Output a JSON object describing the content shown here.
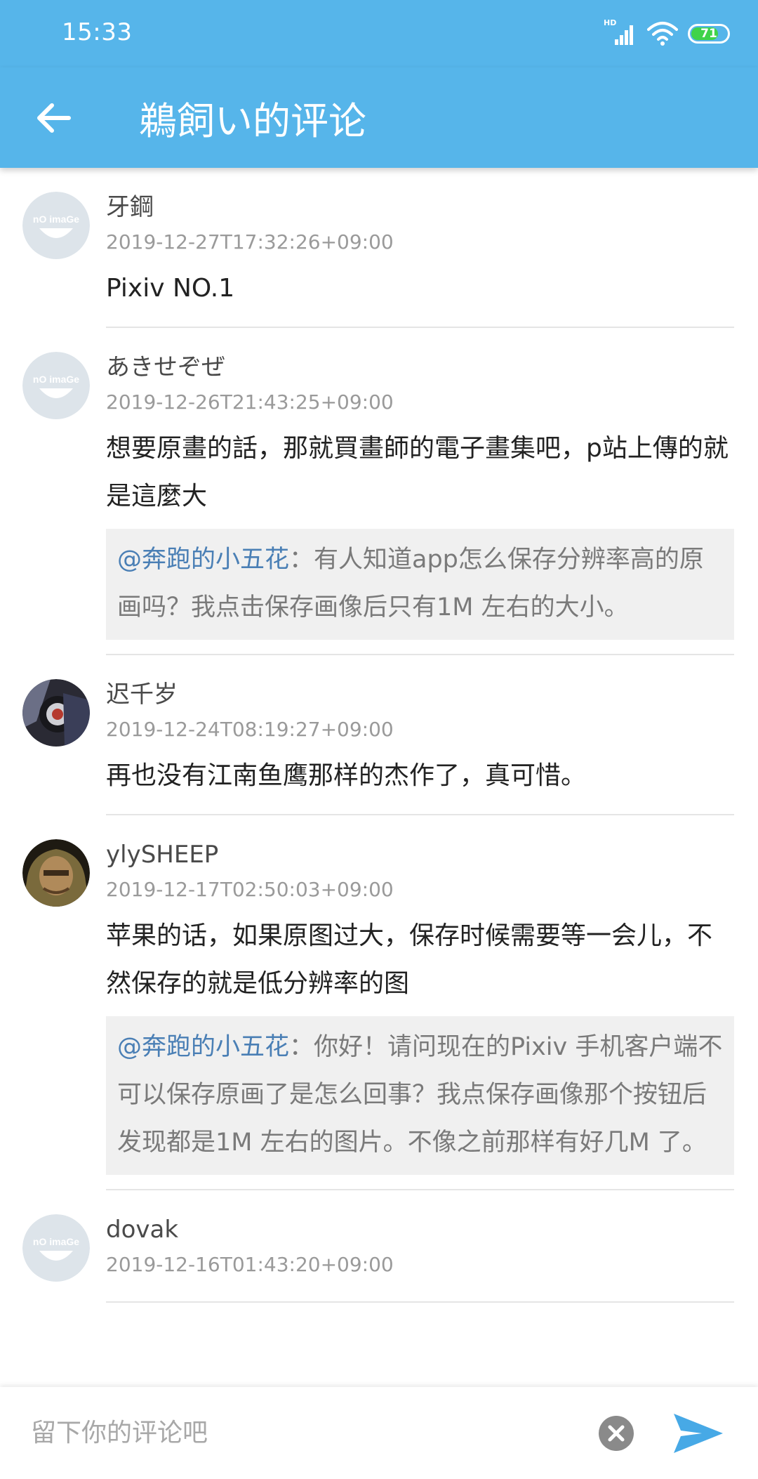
{
  "status_bar": {
    "time": "15:33",
    "network_label": "HD",
    "battery_level": "71",
    "battery_fraction": 0.71,
    "battery_color": "#3fd34a"
  },
  "app_bar": {
    "back_icon": "arrow-left-icon",
    "title": "鵜飼い的评论",
    "color": "#56b5ea"
  },
  "comments": [
    {
      "avatar": "no-image",
      "name": "牙鋼",
      "date": "2019-12-27T17:32:26+09:00",
      "text": "Pixiv NO.1"
    },
    {
      "avatar": "no-image",
      "name": "あきせぞぜ",
      "date": "2019-12-26T21:43:25+09:00",
      "text": "想要原畫的話，那就買畫師的電子畫集吧，p站上傳的就是這麼大",
      "reply": {
        "mention": "@奔跑的小五花",
        "text": "：有人知道app怎么保存分辨率高的原画吗？我点击保存画像后只有1M 左右的大小。"
      }
    },
    {
      "avatar": "photo-headphones",
      "name": "迟千岁",
      "date": "2019-12-24T08:19:27+09:00",
      "text": "再也没有江南鱼鹰那样的杰作了，真可惜。"
    },
    {
      "avatar": "photo-helmet",
      "name": "ylySHEEP",
      "date": "2019-12-17T02:50:03+09:00",
      "text": "苹果的话，如果原图过大，保存时候需要等一会儿，不然保存的就是低分辨率的图",
      "reply": {
        "mention": "@奔跑的小五花",
        "text": "：你好！请问现在的Pixiv 手机客户端不可以保存原画了是怎么回事？我点保存画像那个按钮后发现都是1M 左右的图片。不像之前那样有好几M 了。"
      }
    },
    {
      "avatar": "no-image",
      "name": "dovak",
      "date": "2019-12-16T01:43:20+09:00",
      "text": ""
    }
  ],
  "input_bar": {
    "placeholder": "留下你的评论吧",
    "value": "",
    "clear_icon": "clear-icon",
    "send_icon": "send-icon"
  }
}
